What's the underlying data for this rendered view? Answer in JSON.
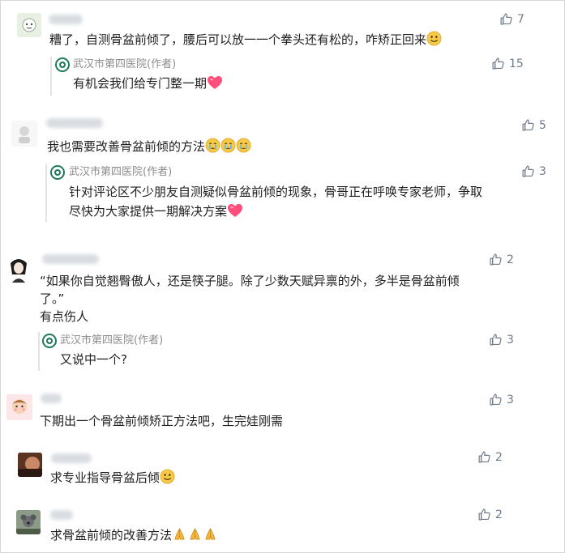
{
  "author_tag": "武汉市第四医院(作者)",
  "comments": [
    {
      "text": "糟了，自测骨盆前倾了，腰后可以放一一个拳头还有松的，咋矫正回来",
      "likes": "7",
      "reply": {
        "text": "有机会我们给专门整一期",
        "likes": "15"
      }
    },
    {
      "text": "我也需要改善骨盆前倾的方法",
      "likes": "5",
      "reply": {
        "text_line1": "针对评论区不少朋友自测疑似骨盆前倾的现象，骨哥正在呼唤专家老师，争取",
        "text_line2": "尽快为大家提供一期解决方案",
        "likes": "3"
      }
    },
    {
      "text_line1": "“如果你自觉翘臀傲人，还是筷子腿。除了少数天赋异禀的外，多半是骨盆前倾",
      "text_line2": "了。”",
      "text_line3": "有点伤人",
      "likes": "2",
      "reply": {
        "text": "又说中一个?",
        "likes": "3"
      }
    },
    {
      "text": "下期出一个骨盆前倾矫正方法吧，生完娃刚需",
      "likes": "3"
    },
    {
      "text": "求专业指导骨盆后倾",
      "likes": "2"
    },
    {
      "text": "求骨盆前倾的改善方法",
      "likes": "2"
    }
  ],
  "icons": {
    "like": "thumbs-up-icon",
    "hospital": "hospital-logo-icon"
  },
  "colors": {
    "reply_bar": "#e3e3e3",
    "like_gray": "#6e7b8a",
    "heart": "#ff4f7a",
    "emoji": "#f7c948",
    "hospital_green": "#1f7a5a"
  }
}
